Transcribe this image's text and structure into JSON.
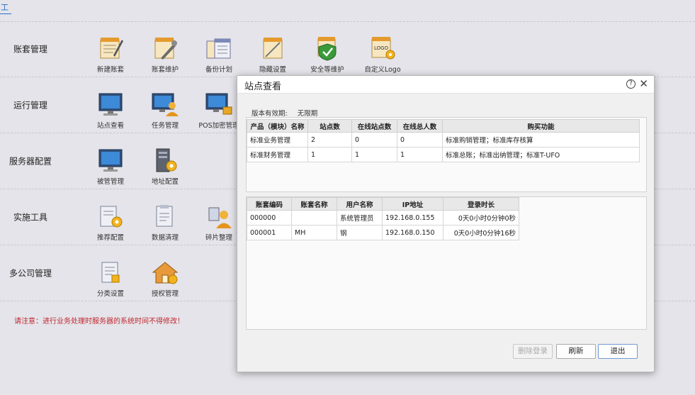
{
  "top_tab": "工",
  "sections": [
    {
      "title": "账套管理",
      "tools": [
        {
          "label": "新建账套",
          "icon": "new-account-icon"
        },
        {
          "label": "账套维护",
          "icon": "maintenance-icon"
        },
        {
          "label": "备份计划",
          "icon": "backup-plan-icon"
        },
        {
          "label": "隐藏设置",
          "icon": "hide-settings-icon"
        },
        {
          "label": "安全等维护",
          "icon": "security-shield-icon"
        },
        {
          "label": "自定义Logo",
          "icon": "logo-icon"
        }
      ]
    },
    {
      "title": "运行管理",
      "tools": [
        {
          "label": "站点查看",
          "icon": "site-monitor-icon"
        },
        {
          "label": "任务管理",
          "icon": "task-user-icon"
        },
        {
          "label": "POS加密管理",
          "icon": "pos-encrypt-icon"
        }
      ]
    },
    {
      "title": "服务器配置",
      "tools": [
        {
          "label": "被管管理",
          "icon": "managed-monitor-icon"
        },
        {
          "label": "地址配置",
          "icon": "address-config-icon"
        }
      ]
    },
    {
      "title": "实施工具",
      "tools": [
        {
          "label": "推荐配置",
          "icon": "recommend-config-icon"
        },
        {
          "label": "数据清理",
          "icon": "data-cleanup-icon"
        },
        {
          "label": "碎片整理",
          "icon": "defrag-user-icon"
        }
      ]
    },
    {
      "title": "多公司管理",
      "tools": [
        {
          "label": "分类设置",
          "icon": "category-settings-icon"
        },
        {
          "label": "授权管理",
          "icon": "license-house-icon"
        }
      ]
    }
  ],
  "notice": "请注意：进行业务处理时服务器的系统时间不得修改！",
  "dialog": {
    "title": "站点查看",
    "validity_label": "版本有效期:",
    "validity_value": "无限期",
    "products": {
      "headers": [
        "产品（模块）名称",
        "站点数",
        "在线站点数",
        "在线总人数",
        "购买功能"
      ],
      "rows": [
        [
          "标准业务管理",
          "2",
          "0",
          "0",
          "标准购销管理；标准库存核算"
        ],
        [
          "标准财务管理",
          "1",
          "1",
          "1",
          "标准总账；标准出纳管理；标准T-UFO"
        ]
      ]
    },
    "sessions": {
      "headers": [
        "账套编码",
        "账套名称",
        "用户名称",
        "IP地址",
        "登录时长"
      ],
      "rows": [
        [
          "000000",
          "",
          "系统管理员",
          "192.168.0.155",
          "0天0小时0分钟0秒"
        ],
        [
          "000001",
          "MH",
          "钢",
          "192.168.0.150",
          "0天0小时0分钟16秒"
        ]
      ]
    },
    "buttons": {
      "remove": "删除登录",
      "refresh": "刷新",
      "exit": "退出"
    }
  }
}
